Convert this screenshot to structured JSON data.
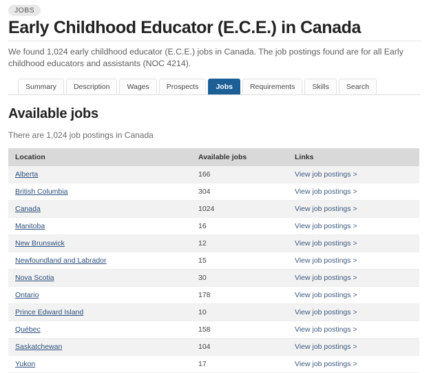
{
  "badge": {
    "label": "JOBS"
  },
  "header": {
    "title": "Early Childhood Educator (E.C.E.) in Canada",
    "intro": "We found 1,024 early childhood educator (E.C.E.) jobs in Canada. The job postings found are for all Early childhood educators and assistants (NOC 4214)."
  },
  "tabs": [
    {
      "label": "Summary",
      "active": false
    },
    {
      "label": "Description",
      "active": false
    },
    {
      "label": "Wages",
      "active": false
    },
    {
      "label": "Prospects",
      "active": false
    },
    {
      "label": "Jobs",
      "active": true
    },
    {
      "label": "Requirements",
      "active": false
    },
    {
      "label": "Skills",
      "active": false
    },
    {
      "label": "Search",
      "active": false
    }
  ],
  "section": {
    "title": "Available jobs",
    "subtext": "There are 1,024 job postings in Canada"
  },
  "table": {
    "columns": [
      "Location",
      "Available jobs",
      "Links"
    ],
    "link_label": "View job postings >",
    "rows": [
      {
        "location": "Alberta",
        "jobs": "166",
        "link": "View job postings >"
      },
      {
        "location": "British Columbia",
        "jobs": "304",
        "link": "View job postings >"
      },
      {
        "location": "Canada",
        "jobs": "1024",
        "link": "View job postings >"
      },
      {
        "location": "Manitoba",
        "jobs": "16",
        "link": "View job postings >"
      },
      {
        "location": "New Brunswick",
        "jobs": "12",
        "link": "View job postings >"
      },
      {
        "location": "Newfoundland and Labrador",
        "jobs": "15",
        "link": "View job postings >"
      },
      {
        "location": "Nova Scotia",
        "jobs": "30",
        "link": "View job postings >"
      },
      {
        "location": "Ontario",
        "jobs": "178",
        "link": "View job postings >"
      },
      {
        "location": "Prince Edward Island",
        "jobs": "10",
        "link": "View job postings >"
      },
      {
        "location": "Québec",
        "jobs": "158",
        "link": "View job postings >"
      },
      {
        "location": "Saskatchewan",
        "jobs": "104",
        "link": "View job postings >"
      },
      {
        "location": "Yukon",
        "jobs": "17",
        "link": "View job postings >"
      }
    ]
  },
  "colors": {
    "active_tab": "#1c5f96",
    "table_header": "#d9d9d9",
    "row_stripe": "#f2f2f2",
    "link": "#2b4f7e"
  }
}
